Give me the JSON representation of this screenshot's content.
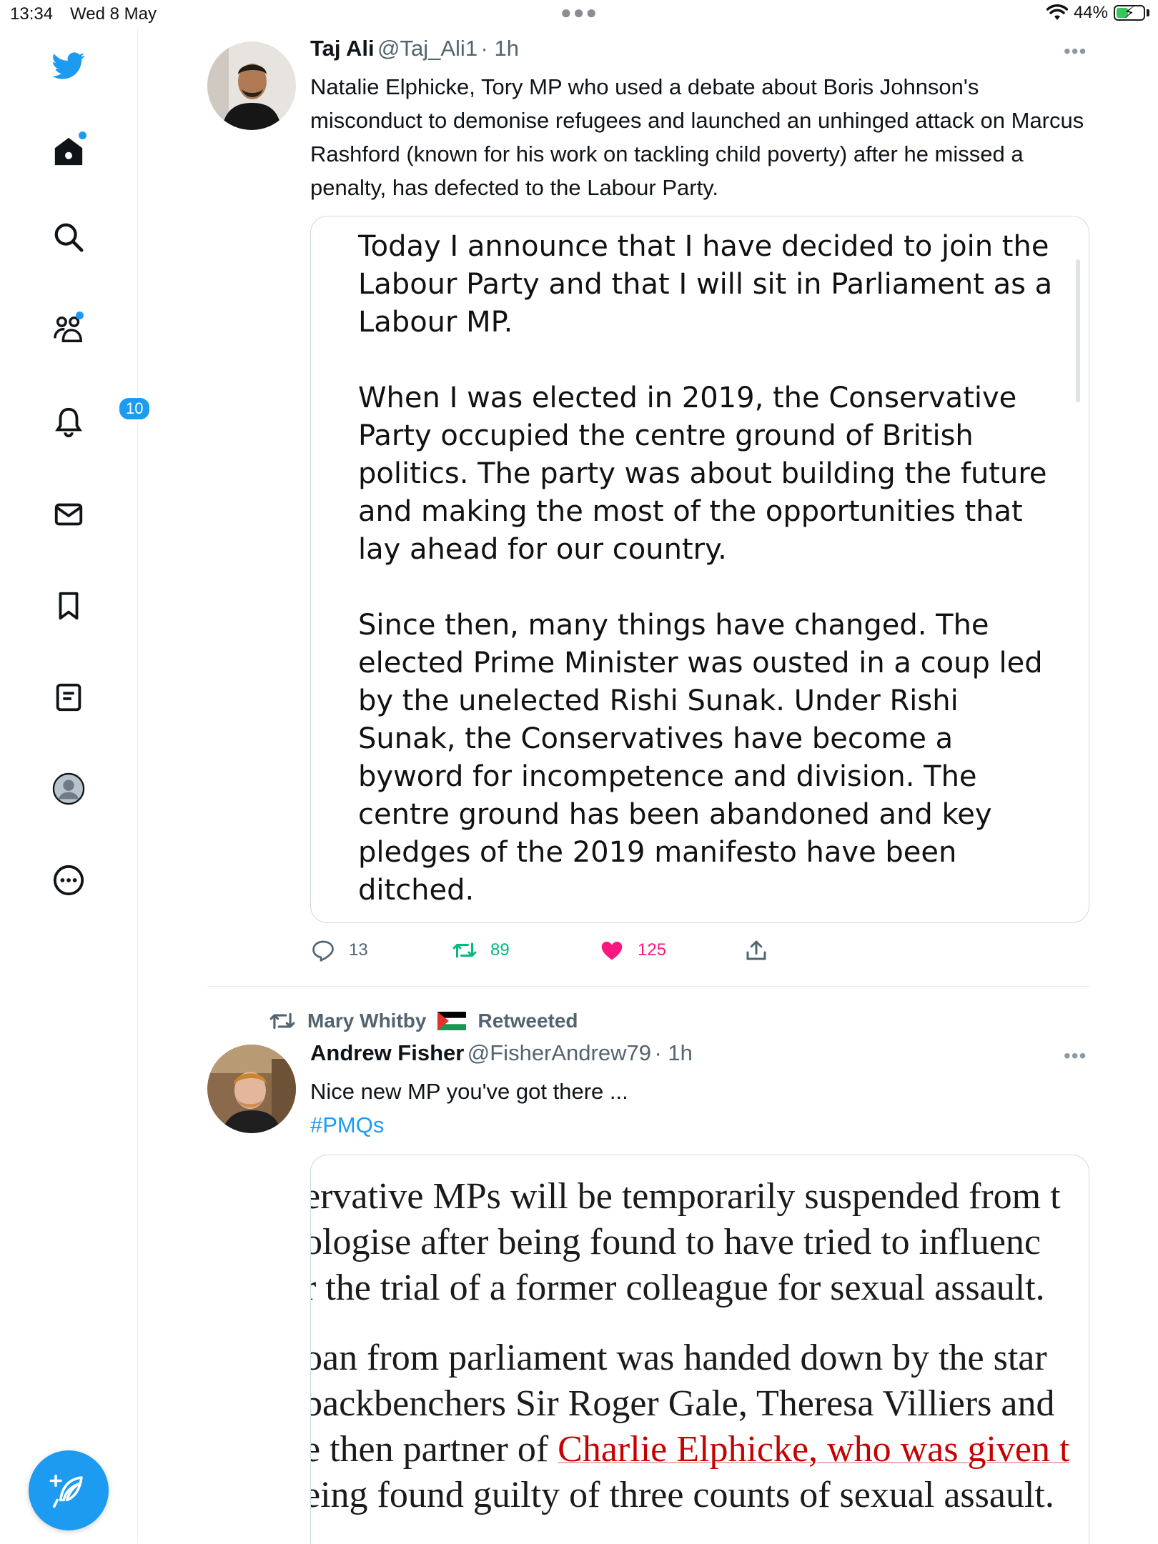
{
  "status_bar": {
    "time": "13:34",
    "date": "Wed 8 May",
    "battery": "44%",
    "battery_level": 0.44
  },
  "sidebar": {
    "icons": [
      "twitter-logo",
      "home-icon",
      "search-icon",
      "communities-icon",
      "notifications-icon",
      "messages-icon",
      "bookmarks-icon",
      "lists-icon",
      "profile-icon",
      "more-icon"
    ],
    "notifications_badge": "10"
  },
  "tweet1": {
    "name": "Taj Ali",
    "handle": "@Taj_Ali1",
    "time": "· 1h",
    "text": "Natalie Elphicke, Tory MP who used a debate about Boris Johnson's misconduct to demonise refugees and launched an unhinged attack on Marcus Rashford (known for his work on tackling child poverty) after he missed a penalty, has defected to the Labour Party.",
    "quote": "Today I announce that I have decided to join the Labour Party and that I will sit in Parliament as a Labour MP.\n\nWhen I was elected in 2019, the Conservative Party occupied the centre ground of British politics. The party was about building the future and making the most of the opportunities that lay ahead for our country.\n\nSince then, many things have changed. The elected Prime Minister was ousted in a coup led by the unelected Rishi Sunak. Under Rishi Sunak, the Conservatives have become a byword for incompetence and division. The centre ground has been abandoned and key pledges of the 2019 manifesto have been ditched.",
    "replies": "13",
    "retweets": "89",
    "likes": "125",
    "colors": {
      "retweet": "#00ba7c",
      "like": "#f91880"
    }
  },
  "tweet2": {
    "retweeted_by": "Mary Whitby",
    "retweeted_label": "Retweeted",
    "name": "Andrew Fisher",
    "handle": "@FisherAndrew79",
    "time": "· 1h",
    "text": "Nice new MP you've got there ...",
    "hashtag": "#PMQs",
    "image_lines": [
      "ervative MPs will be temporarily suspended from t",
      "ologise after being found to have tried to influenc",
      "r the trial of a former colleague for sexual assault.",
      "oan from parliament was handed down by the star",
      " backbenchers Sir Roger Gale, Theresa Villiers and",
      "e then partner of ",
      "Charlie Elphicke, who was given t",
      "eing found guilty of three counts of sexual assault."
    ]
  }
}
